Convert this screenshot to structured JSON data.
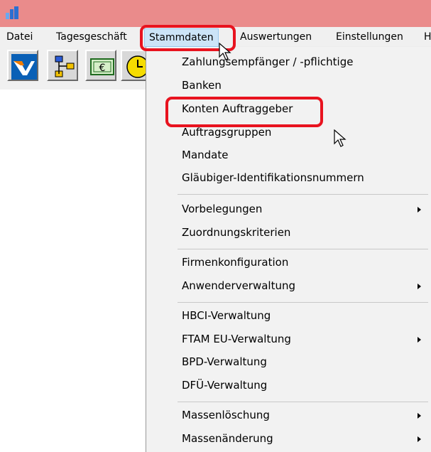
{
  "titlebar": {
    "background": "#ea8b8b",
    "icon": "bar-chart-app-icon"
  },
  "menubar": {
    "items": [
      {
        "label": "Datei"
      },
      {
        "label": "Tagesgeschäft"
      },
      {
        "label": "Stammdaten",
        "active": true
      },
      {
        "label": "Auswertungen"
      },
      {
        "label": "Einstellungen"
      },
      {
        "label": "H"
      }
    ]
  },
  "toolbar": {
    "buttons": [
      {
        "icon": "volksbank-logo-icon"
      },
      {
        "icon": "flowchart-icon"
      },
      {
        "icon": "euro-note-icon"
      },
      {
        "icon": "clock-icon"
      }
    ]
  },
  "dropdown": {
    "groups": [
      [
        {
          "label": "Zahlungsempfänger / -pflichtige"
        },
        {
          "label": "Banken"
        },
        {
          "label": "Konten Auftraggeber",
          "highlighted": true
        },
        {
          "label": "Auftragsgruppen"
        },
        {
          "label": "Mandate"
        },
        {
          "label": "Gläubiger-Identifikationsnummern"
        }
      ],
      [
        {
          "label": "Vorbelegungen",
          "submenu": true
        },
        {
          "label": "Zuordnungskriterien"
        }
      ],
      [
        {
          "label": "Firmenkonfiguration"
        },
        {
          "label": "Anwenderverwaltung",
          "submenu": true
        }
      ],
      [
        {
          "label": "HBCI-Verwaltung"
        },
        {
          "label": "FTAM EU-Verwaltung",
          "submenu": true
        },
        {
          "label": "BPD-Verwaltung"
        },
        {
          "label": "DFÜ-Verwaltung"
        }
      ],
      [
        {
          "label": "Massenlöschung",
          "submenu": true
        },
        {
          "label": "Massenänderung",
          "submenu": true
        }
      ]
    ]
  },
  "highlight_color": "#e8131f"
}
